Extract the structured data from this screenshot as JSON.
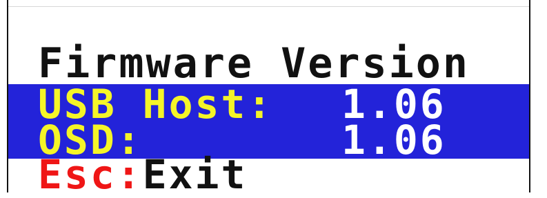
{
  "colors": {
    "background": "#ffffff",
    "selected_band": "#2323d9",
    "label_yellow": "#f5f528",
    "value_white": "#ffffff",
    "title_black": "#111111",
    "escape_red": "#ef1616"
  },
  "osd": {
    "title": "Firmware Version",
    "rows": [
      {
        "label": "USB Host:",
        "value": "1.06"
      },
      {
        "label": "OSD:",
        "value": "1.06"
      }
    ],
    "footer": {
      "key": "Esc:",
      "action": "Exit"
    }
  }
}
